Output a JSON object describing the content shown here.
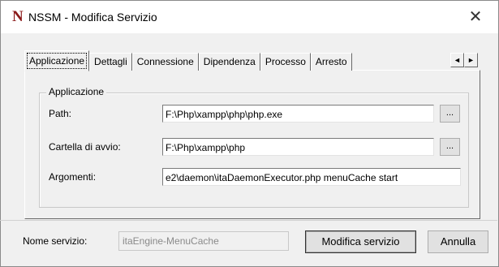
{
  "window": {
    "icon_letter": "N",
    "title": "NSSM - Modifica Servizio",
    "close_glyph": "✕"
  },
  "tabs": [
    {
      "label": "Applicazione",
      "active": true
    },
    {
      "label": "Dettagli",
      "active": false
    },
    {
      "label": "Connessione",
      "active": false
    },
    {
      "label": "Dipendenza",
      "active": false
    },
    {
      "label": "Processo",
      "active": false
    },
    {
      "label": "Arresto",
      "active": false
    }
  ],
  "tab_scroll": {
    "left": "◄",
    "right": "►"
  },
  "application_group": {
    "title": "Applicazione",
    "path_label": "Path:",
    "path_value": "F:\\Php\\xampp\\php\\php.exe",
    "dir_label": "Cartella di avvio:",
    "dir_value": "F:\\Php\\xampp\\php",
    "args_label": "Argomenti:",
    "args_value": "e2\\daemon\\itaDaemonExecutor.php menuCache start",
    "browse_label": "..."
  },
  "footer": {
    "service_name_label": "Nome servizio:",
    "service_name_value": "itaEngine-MenuCache",
    "modify_button": "Modifica servizio",
    "cancel_button": "Annulla"
  }
}
